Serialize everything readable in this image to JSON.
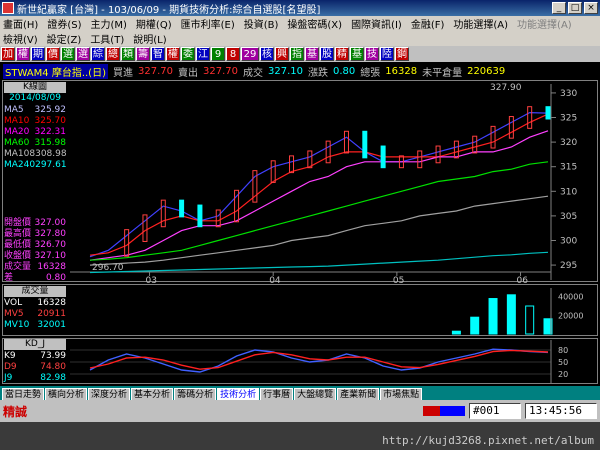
{
  "window": {
    "title": "新世紀贏家 [台灣] - 103/06/09 - 期貨技術分析:綜合自選股[名望股]",
    "min_label": "_",
    "max_label": "□",
    "close_label": "×"
  },
  "menu": {
    "row1": [
      "畫面(H)",
      "證券(S)",
      "主力(M)",
      "期權(Q)",
      "匯市利率(E)",
      "投資(B)",
      "操盤密碼(X)",
      "國際資訊(I)",
      "金融(F)",
      "功能選擇(A)",
      "功能選擇(A)"
    ],
    "row2": [
      "檢視(V)",
      "設定(Z)",
      "工具(T)",
      "說明(L)"
    ]
  },
  "toolbar": {
    "buttons": [
      "加",
      "權",
      "期",
      "價",
      "選",
      "選",
      "綜",
      "總",
      "類",
      "籌",
      "智",
      "權",
      "委",
      "江",
      "9",
      "8",
      "29",
      "核",
      "興",
      "指",
      "基",
      "股",
      "精",
      "基",
      "技",
      "陸",
      "鋼"
    ]
  },
  "quote": {
    "symbol": "STWAM4",
    "name": "摩台指..(日)",
    "bid_label": "買進",
    "bid": "327.70",
    "ask_label": "賣出",
    "ask": "327.70",
    "last_label": "成交",
    "last": "327.10",
    "change_label": "漲跌",
    "change": "0.80",
    "volume_label": "總張",
    "volume": "16328",
    "oi_label": "未平倉量",
    "oi": "220639"
  },
  "price_panel": {
    "chart_type_label": "K線圖",
    "date": "2014/08/09",
    "ma": [
      {
        "label": "MA5",
        "value": "325.92",
        "color": "#ffffff"
      },
      {
        "label": "MA10",
        "value": "325.70",
        "color": "#ff0000"
      },
      {
        "label": "MA20",
        "value": "322.31",
        "color": "#ff00ff"
      },
      {
        "label": "MA60",
        "value": "315.98",
        "color": "#00ff00"
      },
      {
        "label": "MA108",
        "value": "308.98",
        "color": "#c0c0c0"
      },
      {
        "label": "MA240",
        "value": "297.61",
        "color": "#00ffff"
      }
    ],
    "ohlc": [
      {
        "label": "開盤價",
        "value": "327.00"
      },
      {
        "label": "最高價",
        "value": "327.80"
      },
      {
        "label": "最低價",
        "value": "326.70"
      },
      {
        "label": "收盤價",
        "value": "327.10"
      },
      {
        "label": "成交量",
        "value": "16328"
      },
      {
        "label": "差",
        "value": "0.80"
      }
    ],
    "high_marker": "327.90",
    "low_marker": "296.70",
    "y_ticks": [
      "330",
      "325",
      "320",
      "315",
      "310",
      "305",
      "300",
      "295"
    ],
    "x_ticks": [
      "03",
      "04",
      "05",
      "06"
    ]
  },
  "volume_panel": {
    "title": "成交量",
    "rows": [
      {
        "label": "VOL",
        "value": "16328"
      },
      {
        "label": "MV5",
        "value": "20911"
      },
      {
        "label": "MV10",
        "value": "32001"
      }
    ],
    "y_ticks": [
      "40000",
      "20000"
    ]
  },
  "kd_panel": {
    "title": "KD_J",
    "rows": [
      {
        "label": "K9",
        "value": "73.99"
      },
      {
        "label": "D9",
        "value": "74.80"
      },
      {
        "label": "J9",
        "value": "82.98"
      }
    ],
    "y_ticks": [
      "80",
      "50",
      "20"
    ]
  },
  "tabs": [
    "當日走勢",
    "橫向分析",
    "深度分析",
    "基本分析",
    "籌碼分析",
    "技術分析",
    "行事曆",
    "大盤總覽",
    "產業新聞",
    "市場焦點"
  ],
  "active_tab": "技術分析",
  "status": {
    "mode": "精誠",
    "code": "#001",
    "time": "13:45:56"
  },
  "watermark": "http://kujd3268.pixnet.net/album",
  "chart_data": {
    "type": "line",
    "x_ticks": [
      "03",
      "04",
      "05",
      "06"
    ],
    "ylim": [
      294,
      331
    ],
    "series": [
      {
        "name": "MA5",
        "values": [
          296.7,
          298,
          301,
          304,
          307,
          306,
          304,
          305,
          309,
          313,
          315,
          316,
          317,
          319,
          321,
          318,
          316,
          316,
          317,
          318,
          319,
          320,
          322,
          324,
          326,
          325.9
        ]
      },
      {
        "name": "MA10",
        "values": [
          297,
          297.5,
          299,
          302,
          304,
          305,
          304,
          304,
          306,
          309,
          312,
          314,
          315,
          317,
          318,
          318,
          317,
          317,
          317,
          317,
          318,
          319,
          320,
          322,
          324,
          325.7
        ]
      },
      {
        "name": "MA20",
        "values": [
          296,
          296.5,
          297,
          298,
          300,
          302,
          303,
          303,
          304,
          306,
          308,
          310,
          312,
          313,
          315,
          316,
          316,
          316,
          316,
          317,
          317,
          318,
          318,
          319,
          321,
          322.3
        ]
      },
      {
        "name": "MA60",
        "values": [
          296,
          296.2,
          296.5,
          297,
          297.5,
          298,
          299,
          300,
          301,
          302,
          303,
          304,
          305,
          306,
          307,
          308,
          309,
          310,
          311,
          312,
          312.5,
          313,
          314,
          314.5,
          315.5,
          316
        ]
      },
      {
        "name": "MA108",
        "values": [
          295,
          295.2,
          295.4,
          295.6,
          296,
          296.5,
          297,
          297.5,
          298,
          298.5,
          299,
          300,
          300.5,
          301,
          302,
          303,
          303.5,
          304,
          305,
          305.5,
          306,
          307,
          307.5,
          308,
          308.5,
          309
        ]
      },
      {
        "name": "MA240",
        "values": [
          293.5,
          293.6,
          293.7,
          293.8,
          293.9,
          294,
          294.1,
          294.2,
          294.3,
          294.4,
          294.5,
          294.6,
          294.7,
          294.8,
          295,
          295.2,
          295.4,
          295.6,
          295.8,
          296,
          296.3,
          296.6,
          296.9,
          297.1,
          297.4,
          297.6
        ]
      }
    ],
    "volume_values": [
      0,
      0,
      0,
      0,
      0,
      0,
      0,
      0,
      0,
      0,
      0,
      0,
      0,
      0,
      0,
      0,
      0,
      0,
      0,
      0,
      3000,
      18000,
      38000,
      42000,
      30000,
      16328
    ],
    "k_values": [
      30,
      55,
      70,
      60,
      45,
      30,
      25,
      40,
      65,
      80,
      75,
      60,
      50,
      55,
      70,
      60,
      40,
      30,
      35,
      50,
      60,
      70,
      82,
      80,
      76,
      74
    ],
    "d_values": [
      35,
      45,
      60,
      62,
      55,
      42,
      32,
      36,
      52,
      68,
      74,
      68,
      58,
      55,
      62,
      62,
      50,
      38,
      36,
      44,
      54,
      64,
      76,
      79,
      77,
      75
    ]
  }
}
